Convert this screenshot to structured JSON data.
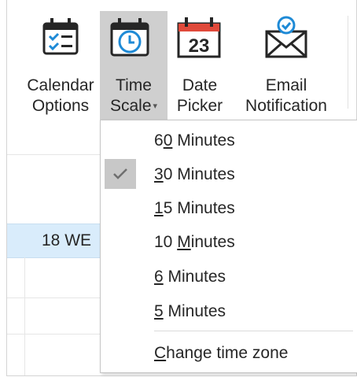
{
  "ribbon": {
    "buttons": [
      {
        "id": "calendar-options",
        "line1": "Calendar",
        "line2": "Options",
        "icon": "calendar-checklist-icon"
      },
      {
        "id": "time-scale",
        "line1": "Time",
        "line2": "Scale",
        "icon": "clock-calendar-icon",
        "has_dropdown": true,
        "pressed": true
      },
      {
        "id": "date-picker",
        "line1": "Date",
        "line2": "Picker",
        "icon": "calendar-23-icon",
        "icon_text": "23"
      },
      {
        "id": "email-notification",
        "line1": "Email",
        "line2": "Notification",
        "icon": "envelope-check-icon"
      }
    ]
  },
  "calendar": {
    "day_label": "18 WE"
  },
  "time_scale_menu": {
    "items": [
      {
        "pre": "6",
        "u": "0",
        "post": " Minutes",
        "checked": false
      },
      {
        "pre": "",
        "u": "3",
        "post": "0 Minutes",
        "checked": true
      },
      {
        "pre": "",
        "u": "1",
        "post": "5 Minutes",
        "checked": false
      },
      {
        "pre": "10 ",
        "u": "M",
        "post": "inutes",
        "checked": false
      },
      {
        "pre": "",
        "u": "6",
        "post": " Minutes",
        "checked": false
      },
      {
        "pre": "",
        "u": "5",
        "post": " Minutes",
        "checked": false
      }
    ],
    "change_tz": {
      "pre": "",
      "u": "C",
      "post": "hange time zone"
    }
  },
  "colors": {
    "accent_blue": "#1e8ad6",
    "date_red": "#e04a3b",
    "pressed_bg": "#cfcfcf",
    "day_highlight": "#d9ecfb"
  }
}
